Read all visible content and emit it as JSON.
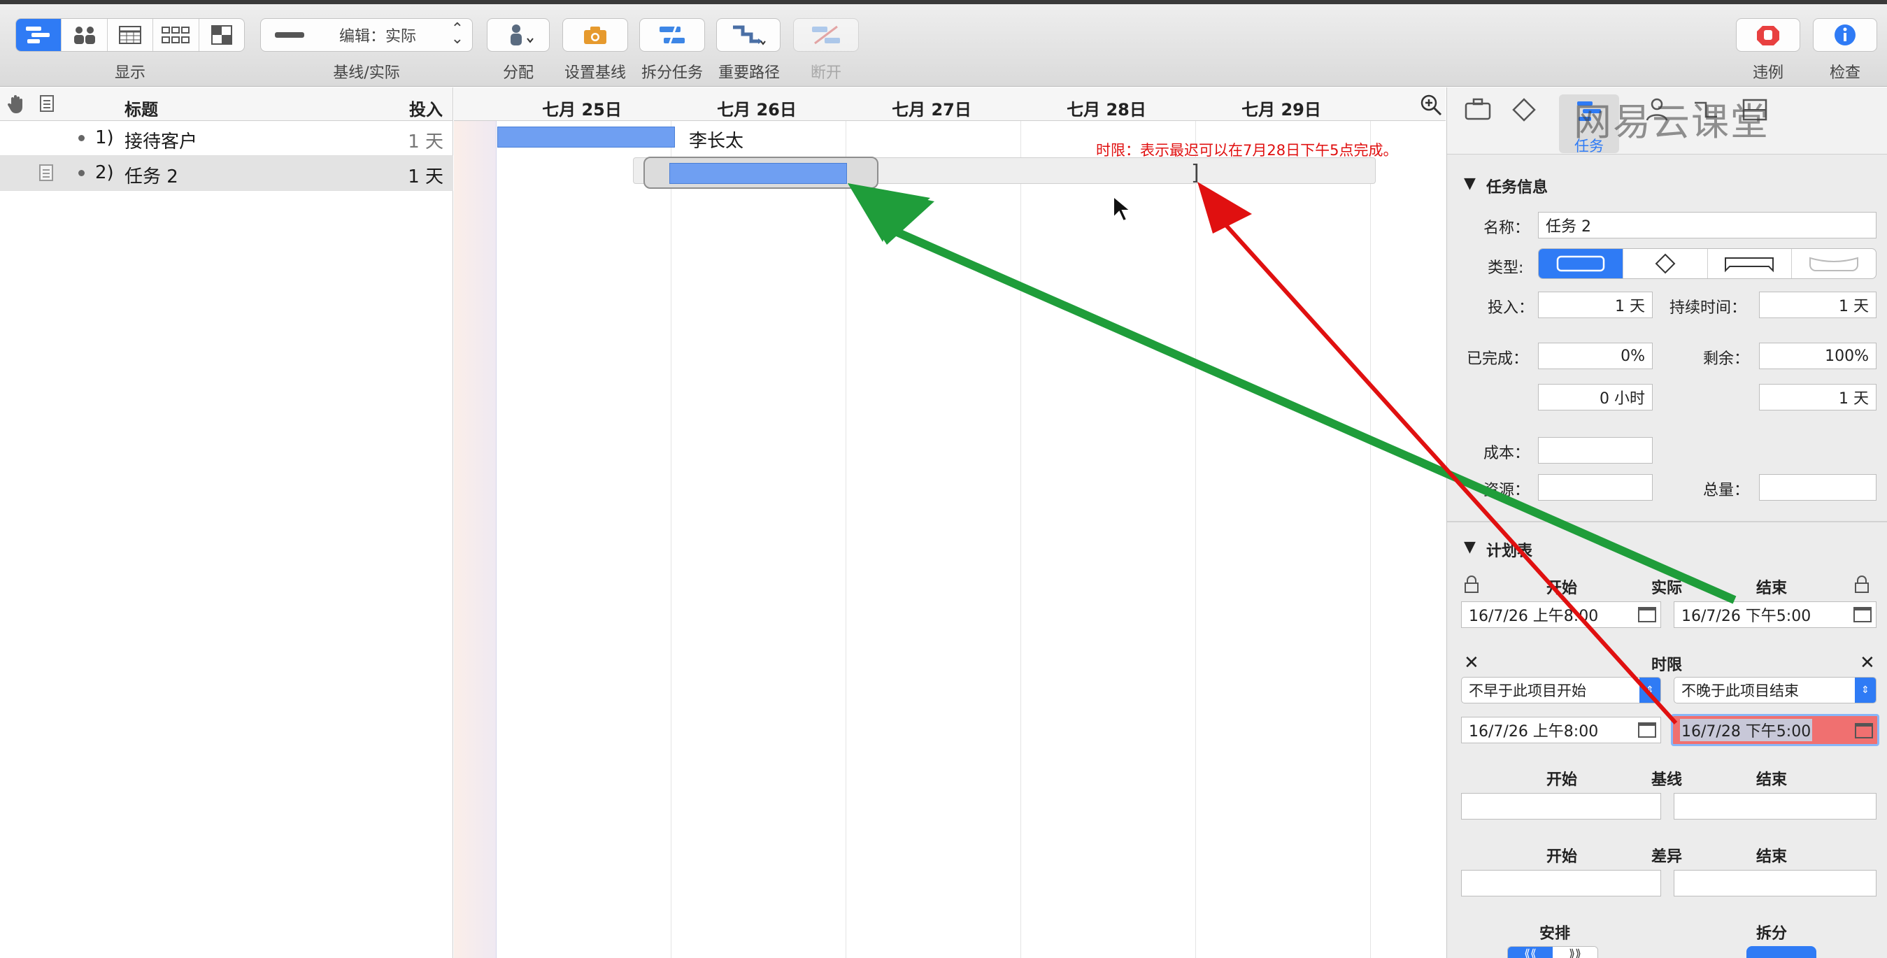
{
  "toolbar": {
    "view_label": "显示",
    "baseline_popup_value": "编辑：实际",
    "baseline_label": "基线/实际",
    "assign_label": "分配",
    "set_baseline_label": "设置基线",
    "split_task_label": "拆分任务",
    "critical_path_label": "重要路径",
    "disconnect_label": "断开",
    "violations_label": "违例",
    "inspect_label": "检查"
  },
  "outline": {
    "col_title": "标题",
    "col_effort": "投入",
    "rows": [
      {
        "number": "1)",
        "title": "接待客户",
        "effort": "1 天",
        "selected": false
      },
      {
        "number": "2)",
        "title": "任务 2",
        "effort": "1 天",
        "selected": true
      }
    ]
  },
  "gantt": {
    "days": [
      "七月 25日",
      "七月 26日",
      "七月 27日",
      "七月 28日",
      "七月 29日"
    ],
    "task1_resource": "李长太",
    "deadline_annotation": "时限：表示最迟可以在7月28日下午5点完成。"
  },
  "inspector": {
    "tab_task_label": "任务",
    "watermark": "网易云课堂",
    "task_info": {
      "header": "任务信息",
      "name_label": "名称：",
      "name_value": "任务 2",
      "type_label": "类型:",
      "effort_label": "投入：",
      "effort_value": "1 天",
      "duration_label": "持续时间：",
      "duration_value": "1 天",
      "completed_label": "已完成：",
      "completed_value": "0%",
      "completed_fraction": 0.0,
      "remaining_label": "剩余：",
      "remaining_value": "100%",
      "completed_hours": "0 小时",
      "remaining_days": "1 天",
      "cost_label": "成本：",
      "cost_value": "",
      "resource_label": "资源：",
      "resource_value": "",
      "total_label": "总量：",
      "total_value": ""
    },
    "schedule": {
      "header": "计划表",
      "start_label": "开始",
      "actual_label": "实际",
      "end_label": "结束",
      "actual_start": "16/7/26 上午8:00",
      "actual_end": "16/7/26 下午5:00",
      "constraint_label": "时限",
      "constraint_start_option": "不早于此项目开始",
      "constraint_end_option": "不晚于此项目结束",
      "constraint_start_date": "16/7/26 上午8:00",
      "constraint_end_date": "16/7/28 下午5:00",
      "baseline_start_label": "开始",
      "baseline_label": "基线",
      "baseline_end_label": "结束",
      "variance_start_label": "开始",
      "variance_label": "差异",
      "variance_end_label": "结束",
      "leveling_label": "安排",
      "split_label": "拆分"
    }
  },
  "colors": {
    "accent": "#2f7bf5",
    "task_bar": "#6f9ff2",
    "annotation_red": "#e01010",
    "annotation_green": "#1f9d3a",
    "highlight_field": "#f07070"
  }
}
